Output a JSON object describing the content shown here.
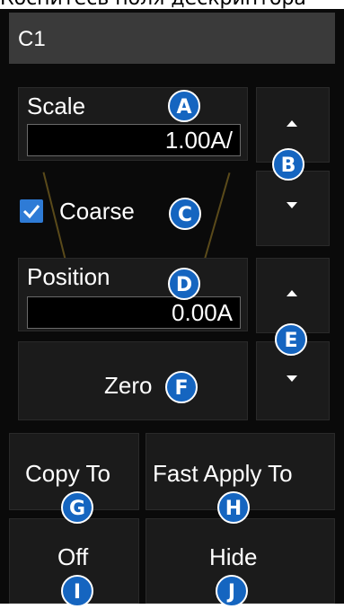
{
  "caption": "Коснитесь поля дескриптора",
  "title": "C1",
  "scale": {
    "label": "Scale",
    "value": "1.00A/"
  },
  "coarse": {
    "label": "Coarse",
    "checked": true
  },
  "position": {
    "label": "Position",
    "value": "0.00A"
  },
  "zero_label": "Zero",
  "copy_to_label": "Copy To",
  "fast_apply_label": "Fast Apply To",
  "off_label": "Off",
  "hide_label": "Hide",
  "badges": {
    "a": "A",
    "b": "B",
    "c": "C",
    "d": "D",
    "e": "E",
    "f": "F",
    "g": "G",
    "h": "H",
    "i": "I",
    "j": "J"
  },
  "colors": {
    "panel": "#0a0a0a",
    "badge": "#1565c0",
    "checkbox": "#2e7bd6"
  }
}
